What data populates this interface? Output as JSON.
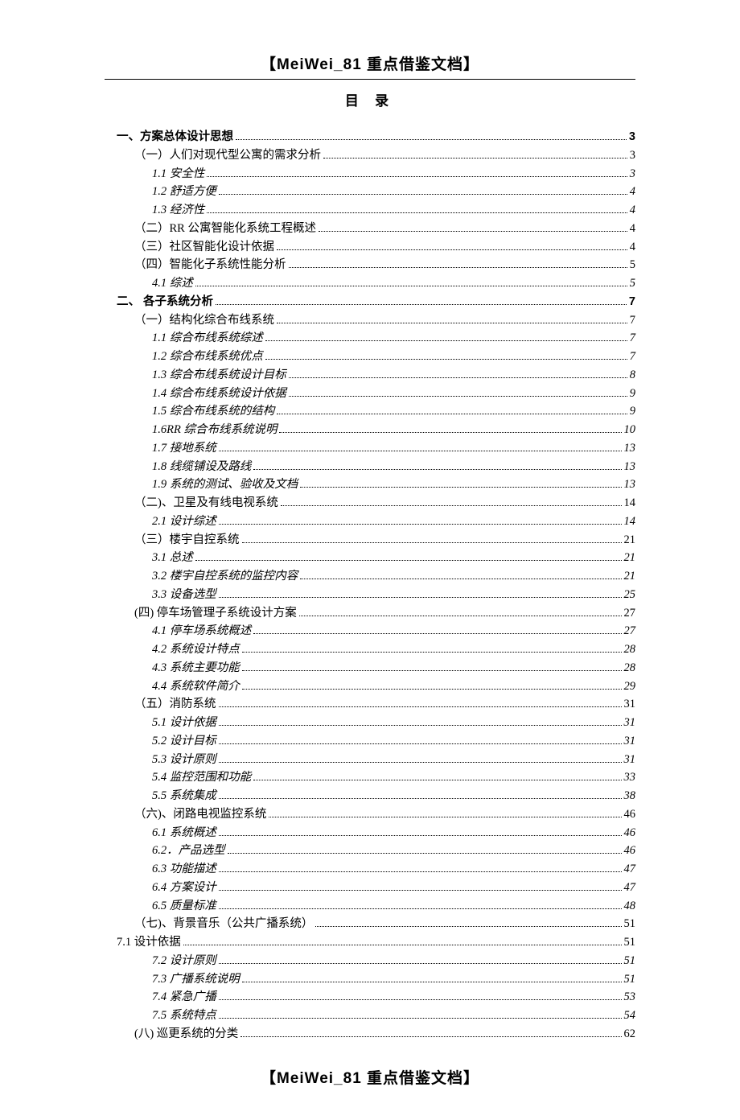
{
  "header": "【MeiWei_81 重点借鉴文档】",
  "footer": "【MeiWei_81 重点借鉴文档】",
  "toc_title": "目  录",
  "toc": [
    {
      "level": "h1",
      "label": "一、方案总体设计思想",
      "page": "3"
    },
    {
      "level": "l1",
      "label": "（一）人们对现代型公寓的需求分析",
      "page": "3"
    },
    {
      "level": "l2",
      "label": "1.1 安全性",
      "page": "3"
    },
    {
      "level": "l2",
      "label": "1.2 舒适方便",
      "page": "4"
    },
    {
      "level": "l2",
      "label": "1.3 经济性",
      "page": "4"
    },
    {
      "level": "l1",
      "label": "（二）RR 公寓智能化系统工程概述",
      "page": "4"
    },
    {
      "level": "l1",
      "label": "（三）社区智能化设计依据",
      "page": "4"
    },
    {
      "level": "l1",
      "label": "（四）智能化子系统性能分析",
      "page": "5"
    },
    {
      "level": "l2",
      "label": "4.1 综述",
      "page": "5"
    },
    {
      "level": "h1",
      "label": "二、 各子系统分析",
      "page": "7"
    },
    {
      "level": "l1",
      "label": "（一）结构化综合布线系统",
      "page": "7"
    },
    {
      "level": "l2",
      "label": "1.1 综合布线系统综述",
      "page": "7"
    },
    {
      "level": "l2",
      "label": "1.2 综合布线系统优点",
      "page": "7"
    },
    {
      "level": "l2",
      "label": "1.3 综合布线系统设计目标",
      "page": "8"
    },
    {
      "level": "l2",
      "label": "1.4 综合布线系统设计依据",
      "page": "9"
    },
    {
      "level": "l2",
      "label": "1.5 综合布线系统的结构",
      "page": "9"
    },
    {
      "level": "l2",
      "label": "1.6RR 综合布线系统说明",
      "page": "10"
    },
    {
      "level": "l2",
      "label": "1.7 接地系统",
      "page": "13"
    },
    {
      "level": "l2",
      "label": "1.8 线缆铺设及路线",
      "page": "13"
    },
    {
      "level": "l2",
      "label": "1.9 系统的测试、验收及文档",
      "page": "13"
    },
    {
      "level": "l1",
      "label": "（二)、卫星及有线电视系统",
      "page": "14"
    },
    {
      "level": "l2",
      "label": "2.1 设计综述",
      "page": "14"
    },
    {
      "level": "l1",
      "label": "（三）楼宇自控系统",
      "page": "21"
    },
    {
      "level": "l2",
      "label": "3.1 总述",
      "page": "21"
    },
    {
      "level": "l2",
      "label": "3.2 楼宇自控系统的监控内容",
      "page": "21"
    },
    {
      "level": "l2",
      "label": "3.3 设备选型",
      "page": "25"
    },
    {
      "level": "l1",
      "label": "(四) 停车场管理子系统设计方案",
      "page": "27"
    },
    {
      "level": "l2",
      "label": "4.1 停车场系统概述",
      "page": "27"
    },
    {
      "level": "l2",
      "label": "4.2 系统设计特点",
      "page": "28"
    },
    {
      "level": "l2",
      "label": "4.3 系统主要功能",
      "page": "28"
    },
    {
      "level": "l2",
      "label": "4.4 系统软件简介",
      "page": "29"
    },
    {
      "level": "l1",
      "label": "（五）消防系统",
      "page": "31"
    },
    {
      "level": "l2",
      "label": "5.1 设计依据",
      "page": "31"
    },
    {
      "level": "l2",
      "label": "5.2 设计目标",
      "page": "31"
    },
    {
      "level": "l2",
      "label": "5.3 设计原则",
      "page": "31"
    },
    {
      "level": "l2",
      "label": "5.4 监控范围和功能",
      "page": "33"
    },
    {
      "level": "l2",
      "label": "5.5 系统集成",
      "page": "38"
    },
    {
      "level": "l1",
      "label": "（六)、闭路电视监控系统",
      "page": "46"
    },
    {
      "level": "l2",
      "label": "6.1 系统概述",
      "page": "46"
    },
    {
      "level": "l2",
      "label": "6.2．产品选型",
      "page": "46"
    },
    {
      "level": "l2",
      "label": "6.3 功能描述",
      "page": "47"
    },
    {
      "level": "l2",
      "label": "6.4 方案设计",
      "page": "47"
    },
    {
      "level": "l2",
      "label": "6.5 质量标准",
      "page": "48"
    },
    {
      "level": "l1",
      "label": "（七)、背景音乐（公共广播系统）",
      "page": "51"
    },
    {
      "level": "l0",
      "label": "7.1 设计依据",
      "page": "51"
    },
    {
      "level": "l2",
      "label": "7.2 设计原则",
      "page": "51"
    },
    {
      "level": "l2",
      "label": "7.3 广播系统说明",
      "page": "51"
    },
    {
      "level": "l2",
      "label": "7.4 紧急广播",
      "page": "53"
    },
    {
      "level": "l2",
      "label": "7.5 系统特点",
      "page": "54"
    },
    {
      "level": "l1",
      "label": "(八) 巡更系统的分类",
      "page": "62"
    }
  ]
}
